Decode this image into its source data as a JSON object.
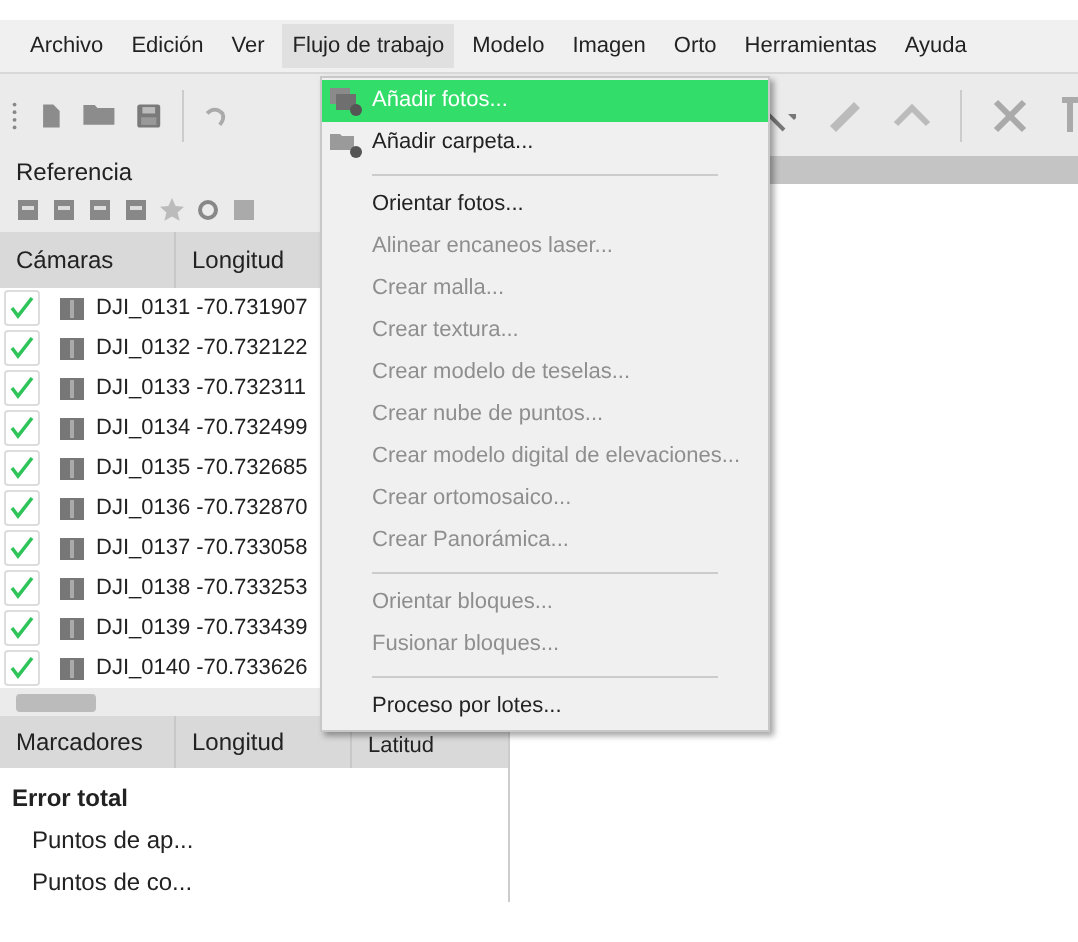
{
  "menubar": [
    {
      "label": "Archivo",
      "selected": false
    },
    {
      "label": "Edición",
      "selected": false
    },
    {
      "label": "Ver",
      "selected": false
    },
    {
      "label": "Flujo de trabajo",
      "selected": true
    },
    {
      "label": "Modelo",
      "selected": false
    },
    {
      "label": "Imagen",
      "selected": false
    },
    {
      "label": "Orto",
      "selected": false
    },
    {
      "label": "Herramientas",
      "selected": false
    },
    {
      "label": "Ayuda",
      "selected": false
    }
  ],
  "reference_panel": {
    "title": "Referencia",
    "cameras_table": {
      "columns": [
        "Cámaras",
        "Longitud"
      ],
      "rows": [
        {
          "name": "DJI_0131",
          "longitude": "-70.731907",
          "checked": true
        },
        {
          "name": "DJI_0132",
          "longitude": "-70.732122",
          "checked": true
        },
        {
          "name": "DJI_0133",
          "longitude": "-70.732311",
          "checked": true
        },
        {
          "name": "DJI_0134",
          "longitude": "-70.732499",
          "checked": true
        },
        {
          "name": "DJI_0135",
          "longitude": "-70.732685",
          "checked": true
        },
        {
          "name": "DJI_0136",
          "longitude": "-70.732870",
          "checked": true
        },
        {
          "name": "DJI_0137",
          "longitude": "-70.733058",
          "checked": true
        },
        {
          "name": "DJI_0138",
          "longitude": "-70.733253",
          "checked": true
        },
        {
          "name": "DJI_0139",
          "longitude": "-70.733439",
          "checked": true
        },
        {
          "name": "DJI_0140",
          "longitude": "-70.733626",
          "checked": true
        }
      ]
    },
    "markers_table": {
      "columns": [
        "Marcadores",
        "Longitud",
        "Latitud"
      ],
      "rows": [
        {
          "label": "Error total",
          "kind": "total"
        },
        {
          "label": "Puntos de ap...",
          "kind": "group"
        },
        {
          "label": "Puntos de co...",
          "kind": "group"
        }
      ]
    }
  },
  "dropdown_menu": [
    {
      "kind": "item",
      "label": "Añadir fotos...",
      "selected": true,
      "disabled": false
    },
    {
      "kind": "item",
      "label": "Añadir carpeta...",
      "selected": false,
      "disabled": false
    },
    {
      "kind": "separator"
    },
    {
      "kind": "item",
      "label": "Orientar fotos...",
      "selected": false,
      "disabled": false
    },
    {
      "kind": "item",
      "label": "Alinear encaneos laser...",
      "selected": false,
      "disabled": true
    },
    {
      "kind": "item",
      "label": "Crear malla...",
      "selected": false,
      "disabled": true
    },
    {
      "kind": "item",
      "label": "Crear textura...",
      "selected": false,
      "disabled": true
    },
    {
      "kind": "item",
      "label": "Crear modelo de teselas...",
      "selected": false,
      "disabled": true
    },
    {
      "kind": "item",
      "label": "Crear nube de puntos...",
      "selected": false,
      "disabled": true
    },
    {
      "kind": "item",
      "label": "Crear modelo digital de elevaciones...",
      "selected": false,
      "disabled": true
    },
    {
      "kind": "item",
      "label": "Crear ortomosaico...",
      "selected": false,
      "disabled": true
    },
    {
      "kind": "item",
      "label": "Crear Panorámica...",
      "selected": false,
      "disabled": true
    },
    {
      "kind": "separator"
    },
    {
      "kind": "item",
      "label": "Orientar bloques...",
      "selected": false,
      "disabled": true
    },
    {
      "kind": "item",
      "label": "Fusionar bloques...",
      "selected": false,
      "disabled": true
    },
    {
      "kind": "separator"
    },
    {
      "kind": "item",
      "label": "Proceso por lotes...",
      "selected": false,
      "disabled": false
    }
  ]
}
